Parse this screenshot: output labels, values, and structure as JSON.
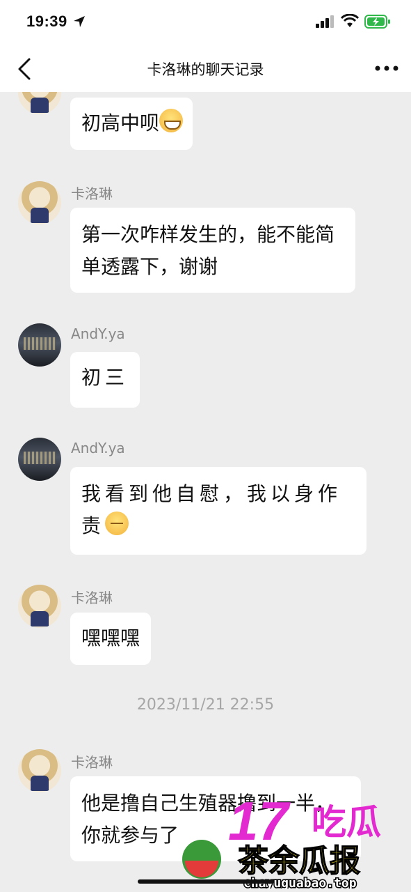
{
  "status_bar": {
    "time": "19:39"
  },
  "header": {
    "title": "卡洛琳的聊天记录"
  },
  "messages": [
    {
      "sender": "",
      "text": "初高中呗",
      "emoji": "grin-icon"
    },
    {
      "sender": "卡洛琳",
      "text": "第一次咋样发生的，能不能简单透露下，谢谢"
    },
    {
      "sender": "AndY.ya",
      "text": "初三"
    },
    {
      "sender": "AndY.ya",
      "text": "我看到他自慰，我以身作责",
      "emoji": "calm-face-icon"
    },
    {
      "sender": "卡洛琳",
      "text": "嘿嘿嘿"
    },
    {
      "sender": "卡洛琳",
      "text": "他是撸自己生殖器撸到一半，你就参与了"
    }
  ],
  "timestamp": "2023/11/21 22:55",
  "watermark": {
    "brand": "17吃瓜",
    "tagline": "茶余瓜报",
    "url": "chayuguabao.top"
  }
}
